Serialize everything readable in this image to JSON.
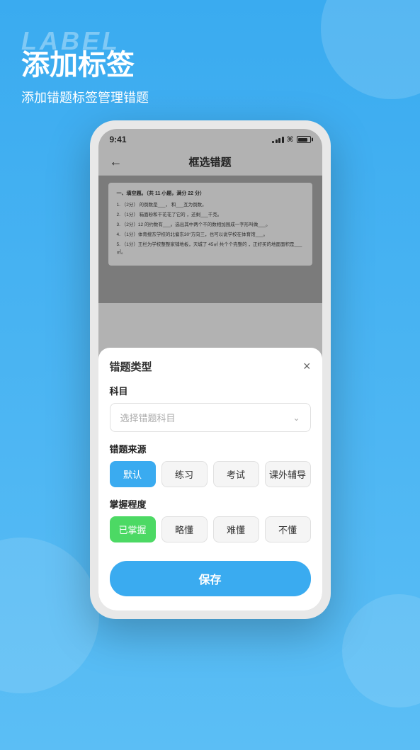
{
  "background": {
    "color": "#3aabf0"
  },
  "header": {
    "watermark": "LABEL",
    "title": "添加标签",
    "subtitle": "添加错题标签管理错题"
  },
  "phone": {
    "status_bar": {
      "time": "9:41",
      "battery_level": 85
    },
    "nav": {
      "back_arrow": "←",
      "title": "框选错题"
    },
    "document": {
      "section_title": "一、填空题。（共 11 小题，满分 22 分）",
      "lines": [
        "1. （2分）  的倒数是___，  和___互为倒数。",
        "2. （1分）  箱面粉和干花花了它的  ，还剩___千克。",
        "3. （2分）12 的约数有___。选出其中两个不的数相加围成一字形叫做___。",
        "4. （1分）体育搜东学校的北偏东30°方向三，也可以说学校在体育馆___。",
        "5. （1分）王栏为学校整整家铺地板，天城了 45㎡ 共个个完整的  ，正好买的地面面积是___㎡。"
      ]
    },
    "modal": {
      "title": "错题类型",
      "close_label": "×",
      "subject_section": "科目",
      "subject_placeholder": "选择错题科目",
      "source_section": "错题来源",
      "source_buttons": [
        {
          "label": "默认",
          "active": true,
          "type": "blue"
        },
        {
          "label": "练习",
          "active": false,
          "type": "none"
        },
        {
          "label": "考试",
          "active": false,
          "type": "none"
        },
        {
          "label": "课外辅导",
          "active": false,
          "type": "none"
        }
      ],
      "mastery_section": "掌握程度",
      "mastery_buttons": [
        {
          "label": "已掌握",
          "active": true,
          "type": "green"
        },
        {
          "label": "略懂",
          "active": false,
          "type": "none"
        },
        {
          "label": "难懂",
          "active": false,
          "type": "none"
        },
        {
          "label": "不懂",
          "active": false,
          "type": "none"
        }
      ],
      "save_label": "保存"
    }
  }
}
